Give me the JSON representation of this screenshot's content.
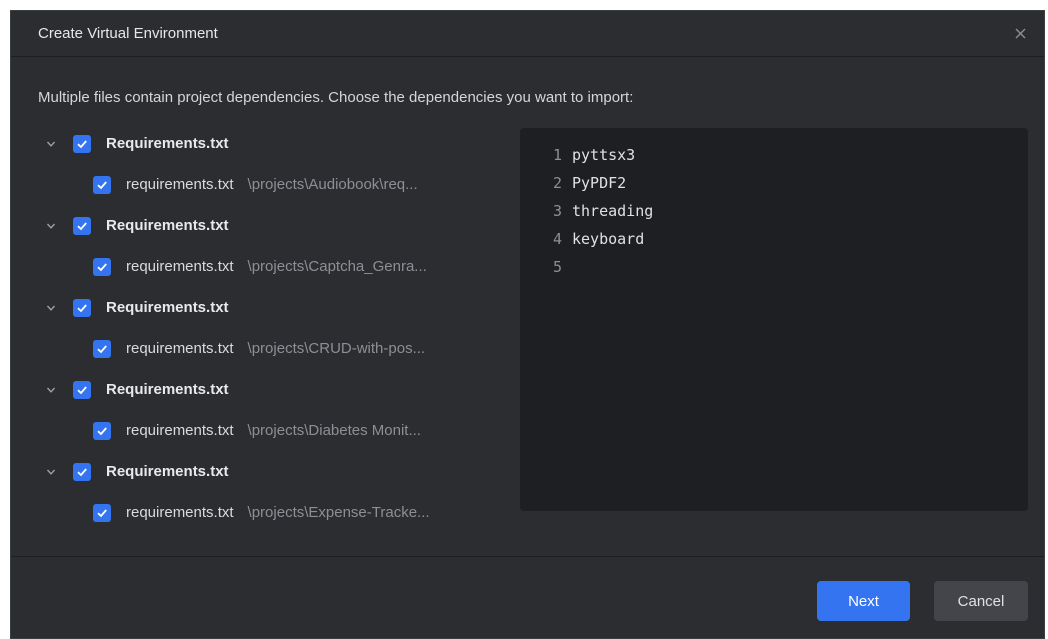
{
  "dialog": {
    "title": "Create Virtual Environment",
    "close_icon": "close-icon",
    "message": "Multiple files contain project dependencies. Choose the dependencies you want to import:"
  },
  "groups": [
    {
      "label": "Requirements.txt",
      "checked": true,
      "expanded": true,
      "file": {
        "name": "requirements.txt",
        "path": "\\projects\\Audiobook\\req...",
        "checked": true
      }
    },
    {
      "label": "Requirements.txt",
      "checked": true,
      "expanded": true,
      "file": {
        "name": "requirements.txt",
        "path": "\\projects\\Captcha_Genra...",
        "checked": true
      }
    },
    {
      "label": "Requirements.txt",
      "checked": true,
      "expanded": true,
      "file": {
        "name": "requirements.txt",
        "path": "\\projects\\CRUD-with-pos...",
        "checked": true
      }
    },
    {
      "label": "Requirements.txt",
      "checked": true,
      "expanded": true,
      "file": {
        "name": "requirements.txt",
        "path": "\\projects\\Diabetes Monit...",
        "checked": true
      }
    },
    {
      "label": "Requirements.txt",
      "checked": true,
      "expanded": true,
      "file": {
        "name": "requirements.txt",
        "path": "\\projects\\Expense-Tracke...",
        "checked": true
      }
    }
  ],
  "preview": {
    "lines": [
      {
        "no": "1",
        "text": "pyttsx3"
      },
      {
        "no": "2",
        "text": "PyPDF2"
      },
      {
        "no": "3",
        "text": "threading"
      },
      {
        "no": "4",
        "text": "keyboard"
      },
      {
        "no": "5",
        "text": ""
      }
    ]
  },
  "footer": {
    "next_label": "Next",
    "cancel_label": "Cancel"
  },
  "colors": {
    "accent": "#3574f0",
    "background": "#2b2d30",
    "editor_background": "#1e1f22"
  }
}
